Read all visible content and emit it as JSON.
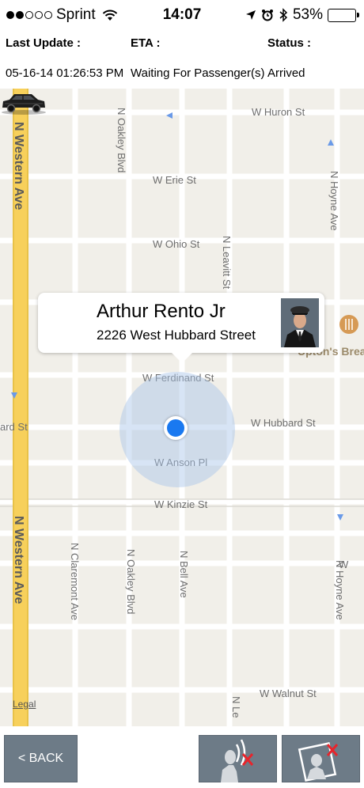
{
  "status_bar": {
    "carrier": "Sprint",
    "time": "14:07",
    "battery": "53%",
    "battery_level": 0.53
  },
  "info": {
    "last_update_label": "Last Update :",
    "eta_label": "ETA :",
    "status_label": "Status :",
    "last_update_value": "05-16-14 01:26:53 PM",
    "eta_value": "Waiting For Passenger(s)",
    "status_value": "Arrived"
  },
  "map": {
    "streets": {
      "huron": "W Huron St",
      "erie": "W Erie St",
      "ohio": "W Ohio St",
      "ferdinand": "W Ferdinand St",
      "hubbard": "W Hubbard St",
      "hubbard_left": "ard St",
      "anson": "W Anson Pl",
      "kinzie": "W Kinzie St",
      "walnut": "W Walnut St",
      "western_top": "N Western Ave",
      "western_bottom": "N Western Ave",
      "oakley_top": "N Oakley Blvd",
      "oakley_bottom": "N Oakley Blvd",
      "leavitt": "N Leavitt St",
      "hoyne_top": "N Hoyne Ave",
      "hoyne_bottom": "N Hoyne Ave",
      "claremont": "N Claremont Ave",
      "bell": "N Bell Ave",
      "bottom_partial": "N Le",
      "right_partial": "W"
    },
    "place": "Upton's Breakfast",
    "legal": "Legal"
  },
  "callout": {
    "driver_name": "Arthur Rento Jr",
    "address": "2226 West Hubbard Street"
  },
  "toolbar": {
    "back_label": "< BACK"
  },
  "colors": {
    "button": "#6d7b87",
    "user_location": "#1a79f0",
    "major_road": "#f7d05b",
    "map_background": "#f1efe9"
  }
}
